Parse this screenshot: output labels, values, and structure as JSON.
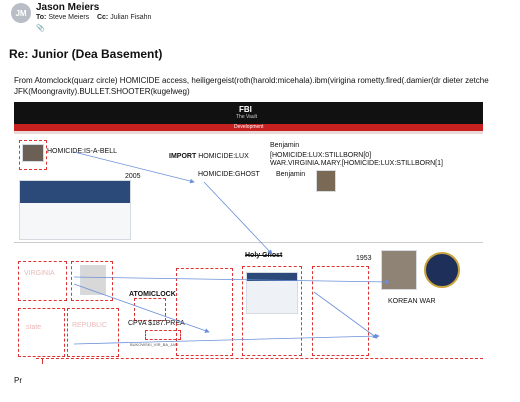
{
  "email": {
    "avatar_initials": "JM",
    "sender": "Jason Meiers",
    "to_label": "To:",
    "to_value": "Steve Meiers",
    "cc_label": "Cc:",
    "cc_value": "Julian Fisahn",
    "subject": "Re: Junior (Dea Basement)",
    "body_line1": "From Atomclock(quarz circle) HOMICIDE access, heiligergeist(roth(harold:micehala).ibm(virigina rometty.fired(.damier(dr dieter zetche",
    "body_line2": "JFK(Moongravity).BULLET.SHOOTER(kugelweg)",
    "closing": "Pr"
  },
  "figure": {
    "banner_title": "FBI",
    "banner_sub": "The Vault",
    "banner_tab": "Development",
    "homicide_bell": "HOMICIDE:IS-A-BELL",
    "import_keyword": "IMPORT",
    "import_value": "HOMICIDE:LUX",
    "benjamin_top": "Benjamin",
    "stillborn_1": "[HOMICIDE:LUX:STILLBORN[0]",
    "stillborn_2": "WAR.VIRGINIA.MARY.[HOMICIDE:LUX:STILLBORN[1]",
    "year_2005": "2005",
    "homicide_ghost": "HOMICIDE:GHOST",
    "benjamin_second": "Benjamin",
    "holy_ghost": "Holy Ghost",
    "year_1953": "1953",
    "korean_war": "KOREAN WAR",
    "atomclock": "ATOMICLOCK",
    "cpva": "CPVA $187.PREA",
    "virginia_ghost": "VIRGINIA",
    "republic_ghost": "REPUBLIC",
    "state_ghost": "state",
    "small_caption": "BUKOWSKI_VIR_BA_JAN"
  },
  "colors": {
    "annotation_red": "#d33333",
    "arrow_blue": "#6a8fd8",
    "banner_black": "#111111",
    "banner_red": "#c62020"
  }
}
